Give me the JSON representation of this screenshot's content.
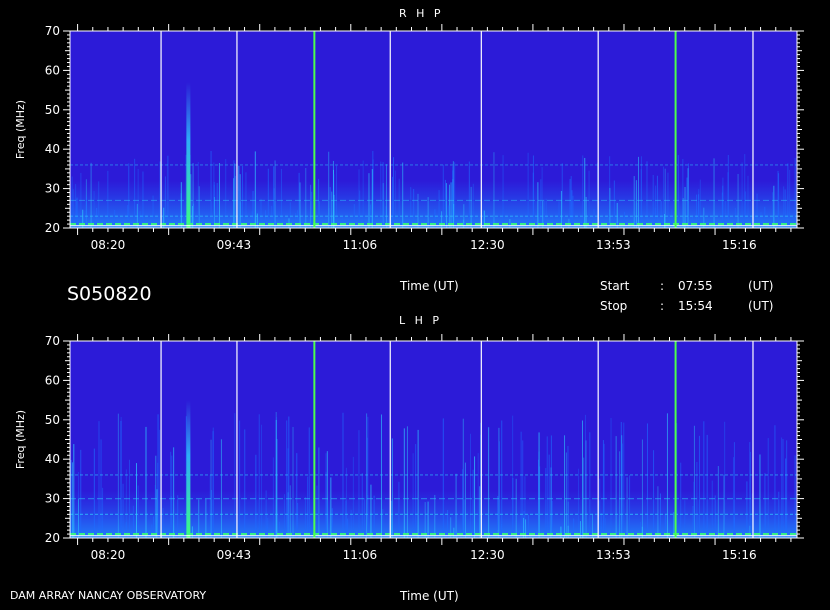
{
  "header": {
    "obs_id": "S050820",
    "time_label_mid": "Time (UT)",
    "time_label_bottom": "Time (UT)",
    "start_label": "Start",
    "start_value": "07:55",
    "stop_label": "Stop",
    "stop_value": "15:54",
    "unit": "(UT)",
    "sep": ":",
    "footer": "DAM ARRAY   NANCAY OBSERVATORY"
  },
  "colors": {
    "background": "#2c1bd8",
    "marker_white": "#ffffff",
    "marker_green": "#4cff4c",
    "emission_low": "#1f6bff",
    "emission_mid": "#2fd0ff",
    "emission_high": "#3bff7a",
    "text": "#ffffff"
  },
  "chart_data": [
    {
      "type": "heatmap",
      "title": "R H P",
      "ylabel": "Freq (MHz)",
      "xlabel": "Time (UT)",
      "ylim": [
        20,
        70
      ],
      "y_ticks": [
        20,
        30,
        40,
        50,
        60,
        70
      ],
      "x_ticks": [
        "08:20",
        "09:43",
        "11:06",
        "12:30",
        "13:53",
        "15:16"
      ],
      "time_range": [
        "07:55",
        "15:54"
      ],
      "markers": [
        {
          "time": "08:55",
          "color": "white"
        },
        {
          "time": "09:45",
          "color": "white"
        },
        {
          "time": "10:36",
          "color": "green"
        },
        {
          "time": "11:26",
          "color": "white"
        },
        {
          "time": "12:26",
          "color": "white"
        },
        {
          "time": "13:43",
          "color": "white"
        },
        {
          "time": "14:34",
          "color": "green"
        },
        {
          "time": "15:25",
          "color": "white"
        }
      ],
      "bursts": [
        {
          "time": "09:13",
          "f_low": 20,
          "f_high": 57
        }
      ],
      "bands": [
        {
          "f": 21,
          "intensity": 0.9
        },
        {
          "f": 23,
          "intensity": 0.55
        },
        {
          "f": 27,
          "intensity": 0.4
        },
        {
          "f": 36,
          "intensity": 0.45
        }
      ],
      "grid": false
    },
    {
      "type": "heatmap",
      "title": "L H P",
      "ylabel": "Freq (MHz)",
      "xlabel": "Time (UT)",
      "ylim": [
        20,
        70
      ],
      "y_ticks": [
        20,
        30,
        40,
        50,
        60,
        70
      ],
      "x_ticks": [
        "08:20",
        "09:43",
        "11:06",
        "12:30",
        "13:53",
        "15:16"
      ],
      "time_range": [
        "07:55",
        "15:54"
      ],
      "markers": [
        {
          "time": "08:55",
          "color": "white"
        },
        {
          "time": "09:45",
          "color": "white"
        },
        {
          "time": "10:36",
          "color": "green"
        },
        {
          "time": "11:26",
          "color": "white"
        },
        {
          "time": "12:26",
          "color": "white"
        },
        {
          "time": "13:43",
          "color": "white"
        },
        {
          "time": "14:34",
          "color": "green"
        },
        {
          "time": "15:25",
          "color": "white"
        }
      ],
      "bursts": [
        {
          "time": "09:13",
          "f_low": 20,
          "f_high": 55
        }
      ],
      "bands": [
        {
          "f": 21,
          "intensity": 0.9
        },
        {
          "f": 26,
          "intensity": 0.6
        },
        {
          "f": 30,
          "intensity": 0.45
        },
        {
          "f": 36,
          "intensity": 0.55
        }
      ],
      "grid": false
    }
  ]
}
